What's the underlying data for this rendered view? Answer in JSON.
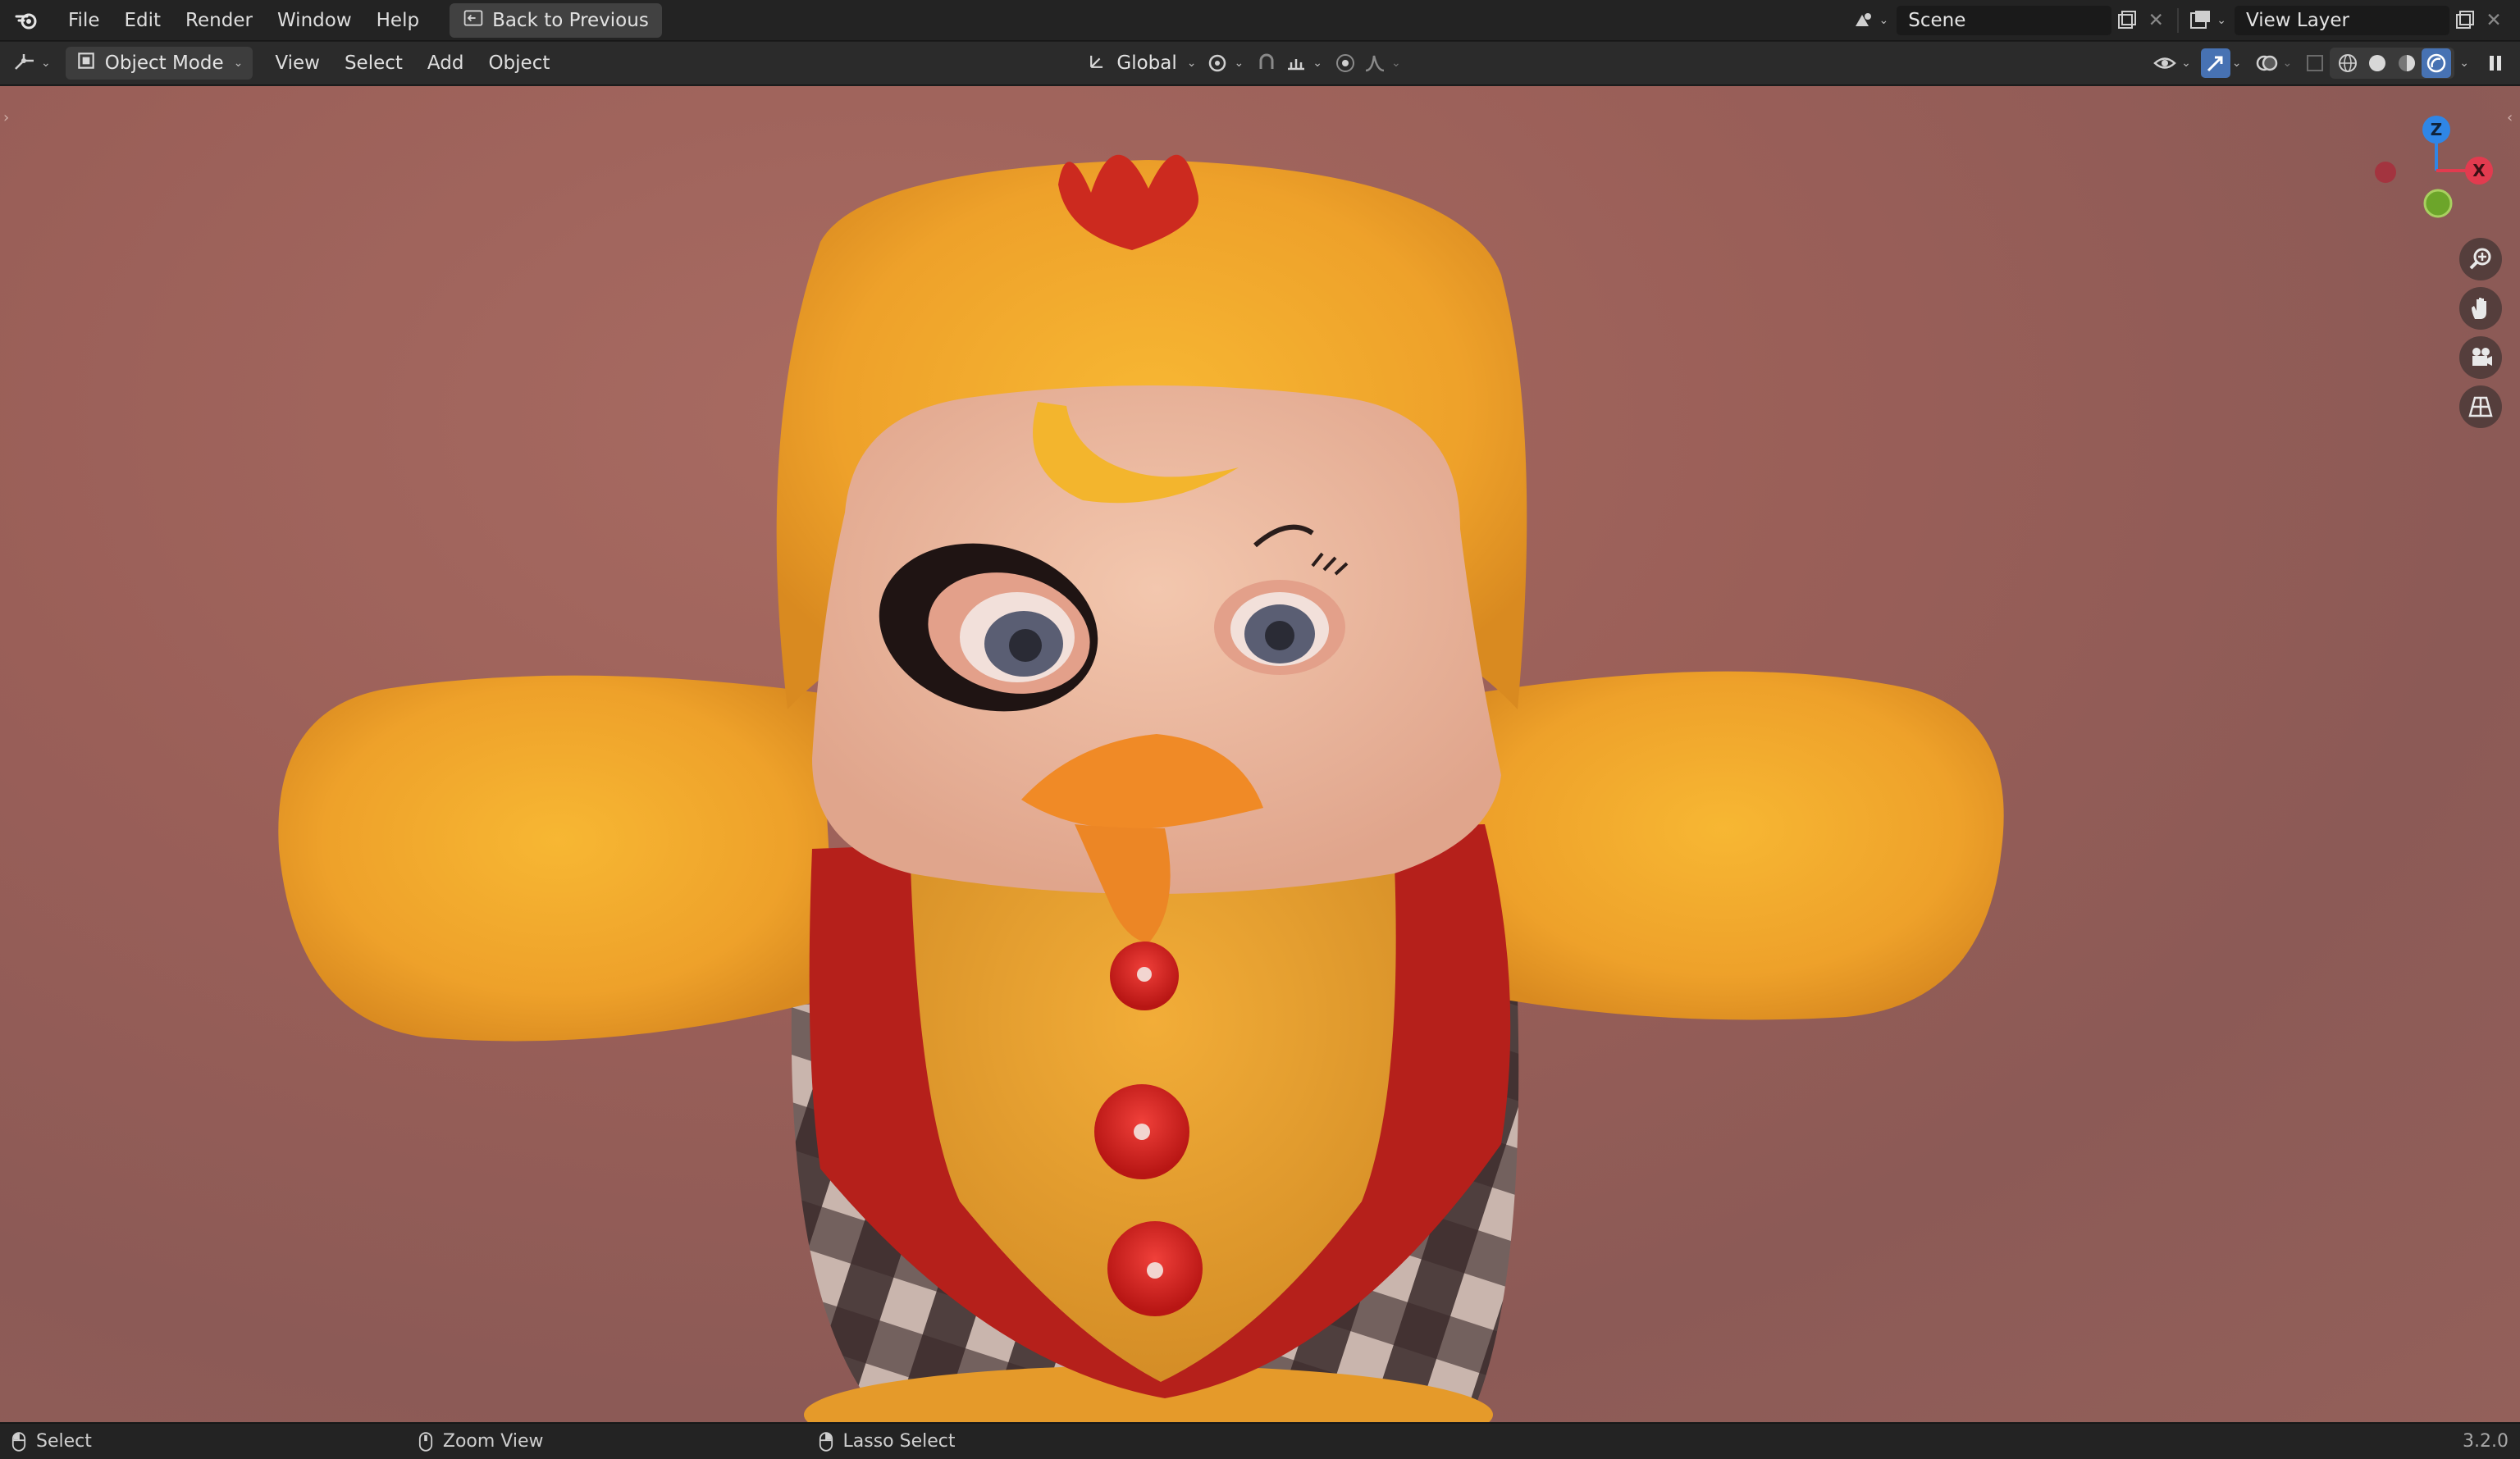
{
  "topbar": {
    "menus": [
      "File",
      "Edit",
      "Render",
      "Window",
      "Help"
    ],
    "back_button": "Back to Previous",
    "scene_name": "Scene",
    "view_layer_name": "View Layer"
  },
  "header": {
    "mode": "Object Mode",
    "menus": [
      "View",
      "Select",
      "Add",
      "Object"
    ],
    "orientation": "Global"
  },
  "gizmo": {
    "z": "Z",
    "x": "X"
  },
  "status": {
    "select": "Select",
    "zoom": "Zoom View",
    "lasso": "Lasso Select",
    "version": "3.2.0"
  },
  "colors": {
    "accent": "#4772b3",
    "axis_x": "#e23b4f",
    "axis_y": "#6ca52a",
    "axis_z": "#2f86e6",
    "fur_yellow": "#f2a625",
    "vest_red": "#b61e1a"
  }
}
